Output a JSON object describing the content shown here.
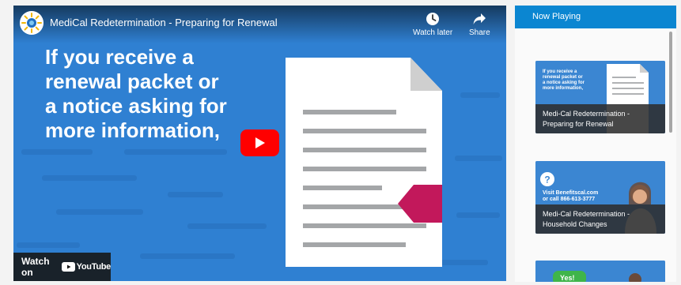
{
  "player": {
    "title": "MediCal Redetermination - Preparing for Renewal",
    "watch_later_label": "Watch later",
    "share_label": "Share",
    "headline_lines": [
      "If you receive a",
      "renewal packet or",
      "a notice asking for",
      "more information,"
    ],
    "watch_on_label": "Watch on",
    "youtube_label": "YouTube"
  },
  "panel": {
    "header": "Now Playing",
    "items": [
      {
        "caption": "Medi-Cal Redetermination - Preparing for Renewal",
        "thumb_lines": [
          "If you receive a",
          "renewal packet or",
          "a notice asking for",
          "more information,"
        ]
      },
      {
        "caption": "Medi-Cal Redetermination - Household Changes",
        "thumb_lines": [
          "Visit Benefitscal.com",
          "or call 866-613-3777"
        ]
      },
      {
        "caption": "",
        "thumb_badge": "Yes!"
      }
    ]
  },
  "colors": {
    "video_bg": "#2e7ed0",
    "panel_header": "#0b86d1",
    "youtube_red": "#ff0000",
    "tag_crimson": "#c2185b"
  }
}
